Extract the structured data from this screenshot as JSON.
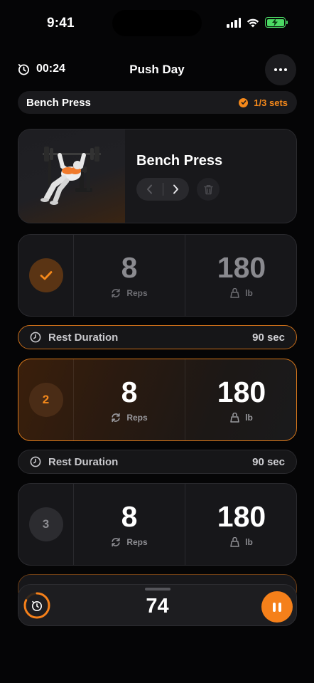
{
  "status_bar": {
    "time": "9:41"
  },
  "header": {
    "elapsed": "00:24",
    "title": "Push Day"
  },
  "exercise_pill": {
    "name": "Bench Press",
    "sets_progress": "1/3 sets"
  },
  "exercise_card": {
    "name": "Bench Press",
    "image_icon": "bench-press-illustration"
  },
  "sets": [
    {
      "badge": "",
      "state": "done",
      "reps": "8",
      "reps_label": "Reps",
      "weight": "180",
      "weight_label": "lb"
    },
    {
      "badge": "2",
      "state": "active",
      "reps": "8",
      "reps_label": "Reps",
      "weight": "180",
      "weight_label": "lb"
    },
    {
      "badge": "3",
      "state": "upcoming",
      "reps": "8",
      "reps_label": "Reps",
      "weight": "180",
      "weight_label": "lb"
    }
  ],
  "rest": [
    {
      "label": "Rest Duration",
      "value": "90 sec"
    },
    {
      "label": "Rest Duration",
      "value": "90 sec"
    }
  ],
  "bottom_bar": {
    "rest_timer_value": "74",
    "ring_progress": 0.82
  },
  "colors": {
    "accent": "#f5891b",
    "background": "#050506",
    "card": "#18181b",
    "battery": "#4cd964"
  }
}
